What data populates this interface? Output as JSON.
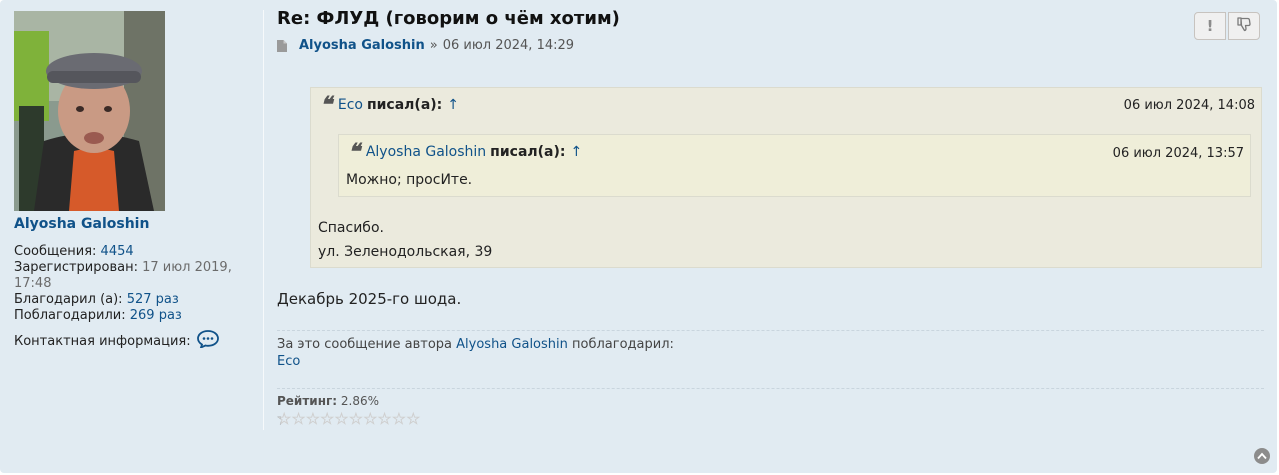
{
  "profile": {
    "username": "Alyosha Galoshin",
    "posts_label": "Сообщения:",
    "posts_value": "4454",
    "registered_label": "Зарегистрирован:",
    "registered_value": "17 июл 2019, 17:48",
    "thanked_label": "Благодарил (а):",
    "thanked_value": "527 раз",
    "was_thanked_label": "Поблагодарили:",
    "was_thanked_value": "269 раз",
    "contact_label": "Контактная информация:"
  },
  "post": {
    "title": "Re: ФЛУД (говорим о чём хотим)",
    "author": "Alyosha Galoshin",
    "sep": "»",
    "date": "06 июл 2024, 14:29",
    "report_button": "!",
    "main_text": "Декабрь 2025-го шода."
  },
  "quote_outer": {
    "author": "Eco",
    "wrote": "писал(а):",
    "arrow": "↑",
    "date": "06 июл 2024, 14:08",
    "lines": [
      "Спасибо.",
      "ул. Зеленодольская, 39"
    ]
  },
  "quote_inner": {
    "author": "Alyosha Galoshin",
    "wrote": "писал(а):",
    "arrow": "↑",
    "date": "06 июл 2024, 13:57",
    "text": "Можно; просИте."
  },
  "thanks": {
    "prefix": "За это сообщение автора",
    "author": "Alyosha Galoshin",
    "suffix": "поблагодарил:",
    "users": "Eco"
  },
  "rating": {
    "label": "Рейтинг:",
    "value": "2.86%",
    "fraction": 0.0286,
    "stars": 10
  },
  "colors": {
    "link": "#105289",
    "panel": "#e1ebf2",
    "quote": "#ebeadd"
  }
}
